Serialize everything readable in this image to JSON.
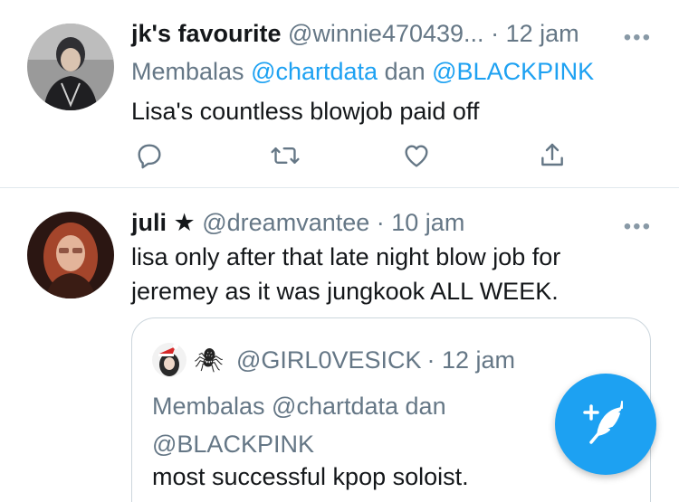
{
  "tweets": [
    {
      "display_name": "jk's favourite",
      "handle": "@winnie470439...",
      "time": "· 12 jam",
      "more": "•••",
      "reply_prefix": "Membalas",
      "reply_mention_1": "@chartdata",
      "reply_joiner": "dan",
      "reply_mention_2": "@BLACKPINK",
      "text": "Lisa's countless blowjob paid off",
      "actions": [
        "reply-icon",
        "retweet-icon",
        "like-icon",
        "share-icon"
      ]
    },
    {
      "display_name": "juli",
      "badge": "★",
      "handle": "@dreamvantee",
      "time": "· 10 jam",
      "more": "•••",
      "text_line_1": "lisa only after that late night blow job for",
      "text_line_2": "jeremey as it was jungkook ALL WEEK.",
      "quote": {
        "emoji": "🕷",
        "handle": "@GIRL0VESICK",
        "time": "· 12 jam",
        "reply_line_1": "Membalas @chartdata dan",
        "reply_line_2": "@BLACKPINK",
        "text": "most successful kpop soloist."
      }
    }
  ],
  "fab": {
    "icon": "compose-tweet-icon"
  },
  "colors": {
    "accent": "#1da1f2",
    "secondary_text": "#657786",
    "border": "#e1e8ed"
  }
}
